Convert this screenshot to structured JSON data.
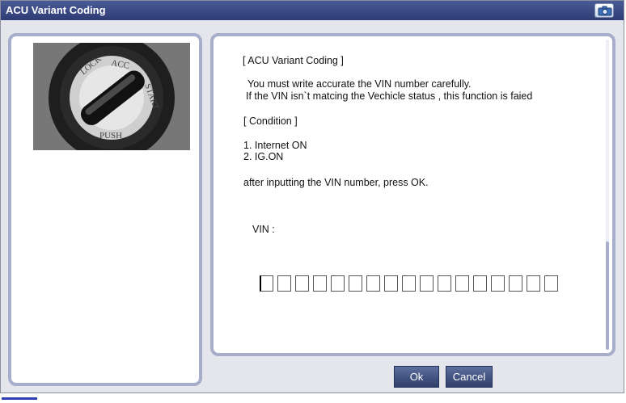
{
  "window": {
    "title": "ACU Variant Coding"
  },
  "content": {
    "heading": "[ ACU Variant Coding ]",
    "warning_line1": "You must write accurate  the VIN number carefully.",
    "warning_line2": "If the VIN isn`t matcing the Vechicle status , this function is faied",
    "condition_heading": "[ Condition ]",
    "condition_1": "1. Internet ON",
    "condition_2": "2. IG.ON",
    "instruction": "after inputting the VIN number, press OK.",
    "vin_label": "VIN :",
    "vin_value": "",
    "vin_box_count": 17
  },
  "buttons": {
    "ok": "Ok",
    "cancel": "Cancel"
  },
  "icons": {
    "title_bar_button": "camera-icon",
    "left_image": "ignition-key-image"
  },
  "colors": {
    "title_bar": "#2e3c74",
    "panel_border": "#a7aecb",
    "button": "#3d4d7c"
  }
}
